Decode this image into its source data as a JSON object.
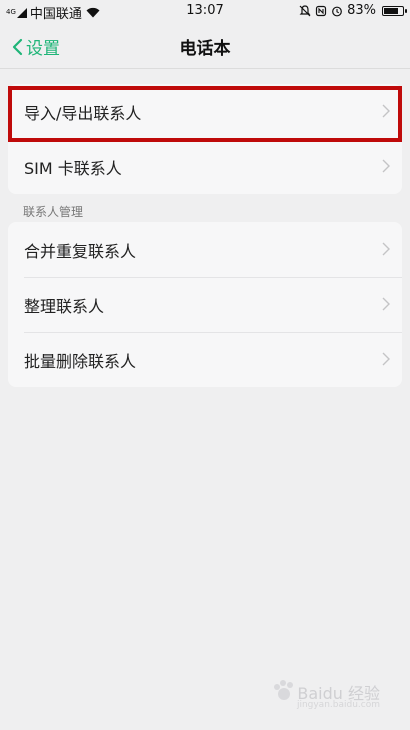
{
  "status_bar": {
    "network_type": "4G",
    "carrier": "中国联通",
    "time": "13:07",
    "battery_percent": "83%",
    "battery_level": 0.83
  },
  "nav": {
    "back_label": "设置",
    "title": "电话本"
  },
  "group_top": {
    "items": [
      {
        "label": "导入/导出联系人"
      },
      {
        "label": "SIM 卡联系人"
      }
    ]
  },
  "section": {
    "header": "联系人管理"
  },
  "group_manage": {
    "items": [
      {
        "label": "合并重复联系人"
      },
      {
        "label": "整理联系人"
      },
      {
        "label": "批量删除联系人"
      }
    ]
  },
  "watermark": {
    "text": "Baidu 经验",
    "url": "jingyan.baidu.com"
  },
  "colors": {
    "accent": "#1fb578",
    "highlight": "#bf0a0a"
  }
}
